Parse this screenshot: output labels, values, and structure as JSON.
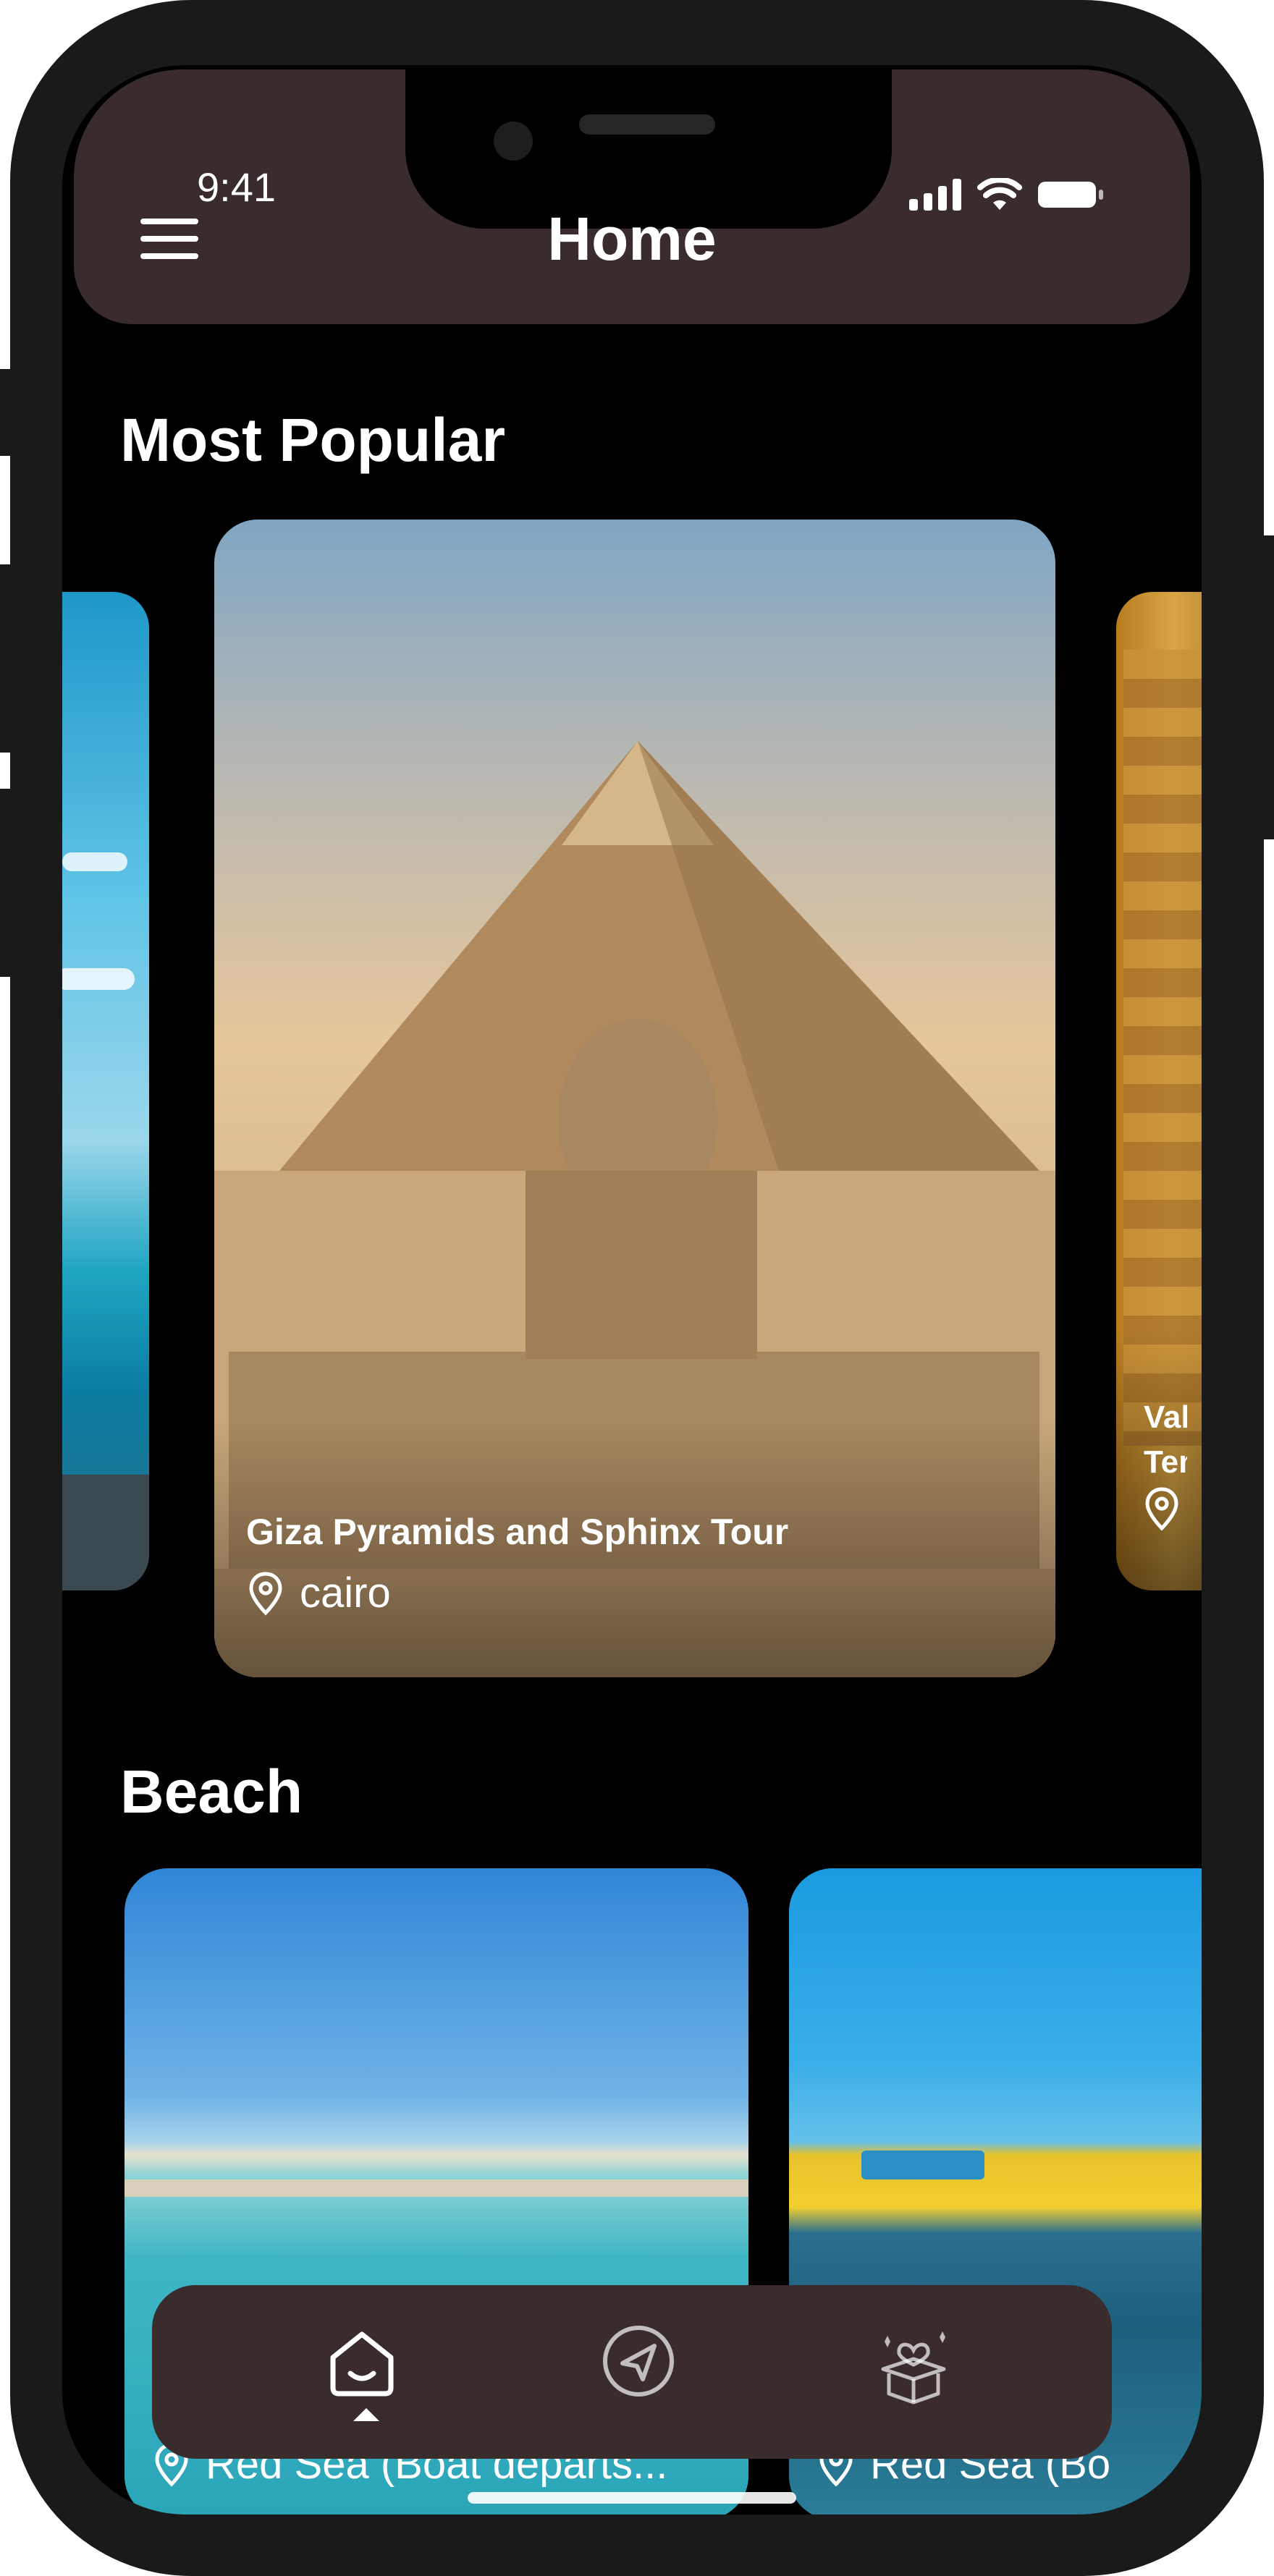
{
  "status_bar": {
    "time": "9:41"
  },
  "header": {
    "title": "Home",
    "menu_icon": "hamburger-menu-icon"
  },
  "sections": {
    "popular": {
      "title": "Most Popular",
      "cards": [
        {
          "name": "",
          "location": ""
        },
        {
          "name": "Giza Pyramids and Sphinx Tour",
          "location": "cairo"
        },
        {
          "name": "Vall Tem",
          "location": ""
        }
      ]
    },
    "beach": {
      "title": "Beach",
      "cards": [
        {
          "name": "",
          "location": "Red Sea (Boat departs..."
        },
        {
          "name": "",
          "location": "Red Sea (Bo"
        }
      ]
    }
  },
  "bottom_nav": {
    "items": [
      {
        "icon": "home-icon",
        "active": true
      },
      {
        "icon": "navigation-icon",
        "active": false
      },
      {
        "icon": "gift-box-heart-icon",
        "active": false
      }
    ]
  },
  "colors": {
    "header_bg": "#3a2c2d",
    "screen_bg": "#000000",
    "frame": "#1b1a1a"
  }
}
